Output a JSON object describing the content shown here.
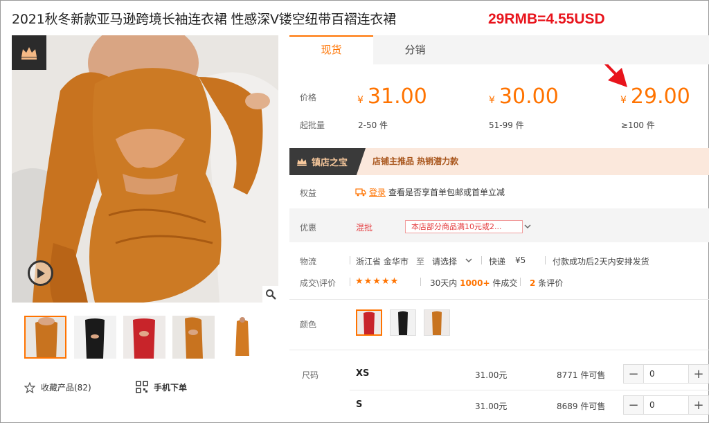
{
  "product": {
    "title": "2021秋冬新款亚马逊跨境长袖连衣裙 性感深V镂空纽带百褶连衣裙"
  },
  "annotation": {
    "text": "29RMB=4.55USD",
    "color": "#e8141c"
  },
  "gallery": {
    "badge_icon": "crown-icon",
    "thumbnails": [
      {
        "name": "orange-front",
        "color": "#c8731f"
      },
      {
        "name": "black",
        "color": "#1a1a1a"
      },
      {
        "name": "red",
        "color": "#c8242a"
      },
      {
        "name": "orange-side",
        "color": "#c8731f"
      },
      {
        "name": "orange-back",
        "color": "#d27a22"
      }
    ],
    "favorite_label": "收藏产品(82)",
    "mobile_label": "手机下单"
  },
  "tabs": [
    {
      "label": "现货",
      "active": true
    },
    {
      "label": "分销",
      "active": false
    }
  ],
  "pricing": {
    "price_label": "价格",
    "moq_label": "起批量",
    "currency_symbol": "¥",
    "tiers": [
      {
        "price": "31.00",
        "range": "2-50 件"
      },
      {
        "price": "30.00",
        "range": "51-99 件"
      },
      {
        "price": "29.00",
        "range": "≥100 件"
      }
    ]
  },
  "treasure": {
    "badge": "镇店之宝",
    "text": "店铺主推品   热销潜力款"
  },
  "rights": {
    "label": "权益",
    "login": "登录",
    "text": "查看是否享首单包邮或首单立减"
  },
  "discount": {
    "label": "优惠",
    "type": "混批",
    "tag": "本店部分商品满10元或2..."
  },
  "logistics": {
    "label": "物流",
    "from": "浙江省 金华市",
    "to_word": "至",
    "destination": "请选择",
    "method": "快递",
    "fee": "¥5",
    "ship_note": "付款成功后2天内安排发货"
  },
  "trades": {
    "label": "成交\\评价",
    "stars": "★★★★★",
    "period": "30天内",
    "count": "1000+",
    "count_suffix": "件成交",
    "reviews": "2",
    "reviews_suffix": "条评价"
  },
  "colors": {
    "label": "颜色",
    "swatches": [
      {
        "name": "red",
        "color": "#c8242a",
        "active": true
      },
      {
        "name": "black",
        "color": "#1a1a1a",
        "active": false
      },
      {
        "name": "orange",
        "color": "#c8731f",
        "active": false
      }
    ]
  },
  "sizes": {
    "label": "尺码",
    "rows": [
      {
        "size": "XS",
        "price": "31.00元",
        "stock": "8771 件可售",
        "qty": "0"
      },
      {
        "size": "S",
        "price": "31.00元",
        "stock": "8689 件可售",
        "qty": "0"
      }
    ]
  }
}
